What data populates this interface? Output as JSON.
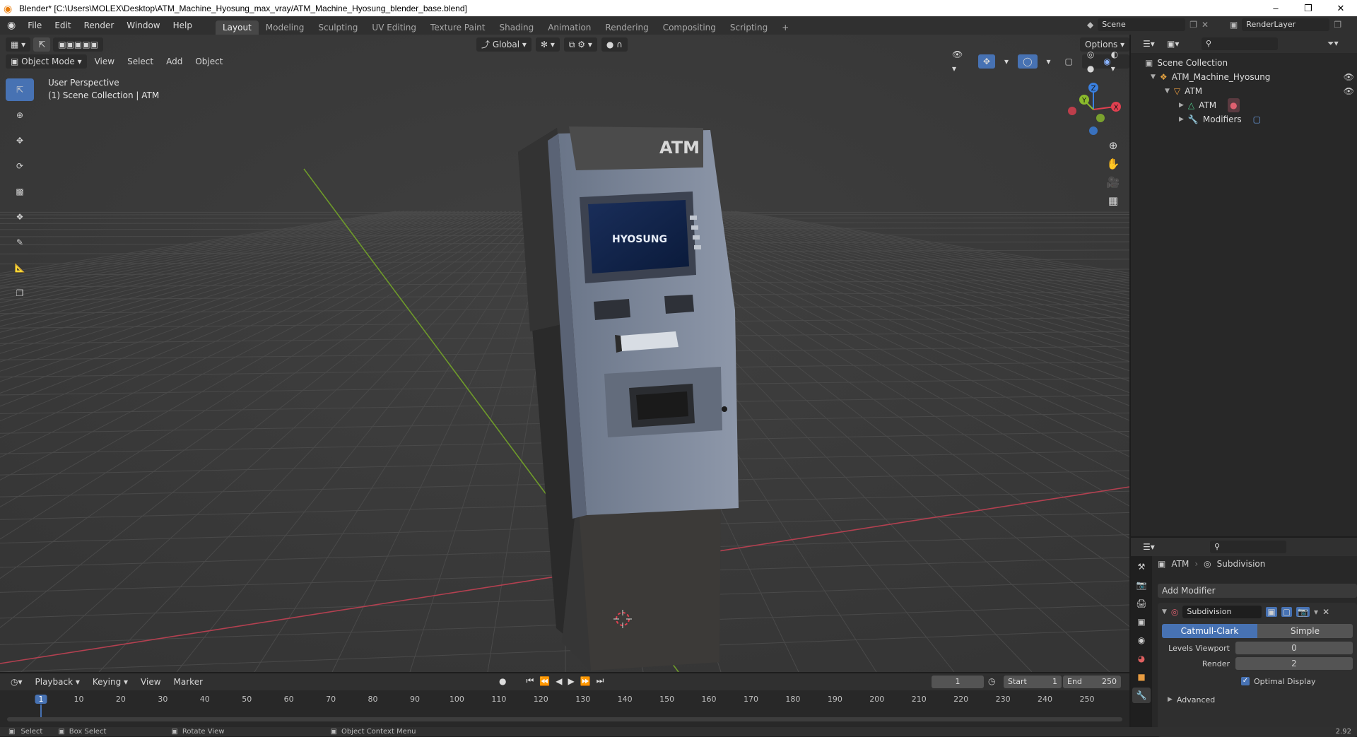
{
  "window": {
    "title": "Blender* [C:\\Users\\MOLEX\\Desktop\\ATM_Machine_Hyosung_max_vray/ATM_Machine_Hyosung_blender_base.blend]"
  },
  "menu": [
    "File",
    "Edit",
    "Render",
    "Window",
    "Help"
  ],
  "workspaces": [
    "Layout",
    "Modeling",
    "Sculpting",
    "UV Editing",
    "Texture Paint",
    "Shading",
    "Animation",
    "Rendering",
    "Compositing",
    "Scripting"
  ],
  "active_workspace": "Layout",
  "scene": {
    "name": "Scene",
    "render_layer": "RenderLayer"
  },
  "viewport": {
    "mode": "Object Mode",
    "header_menus": [
      "View",
      "Select",
      "Add",
      "Object"
    ],
    "orientation": "Global",
    "options_label": "Options",
    "perspective_label": "User Perspective",
    "collection_label": "(1) Scene Collection | ATM",
    "atm_sign": "ATM",
    "screen_brand": "HYOSUNG"
  },
  "outliner": {
    "root": "Scene Collection",
    "items": [
      {
        "label": "ATM_Machine_Hyosung",
        "icon": "collection-icon"
      },
      {
        "label": "ATM",
        "icon": "object-icon"
      },
      {
        "label": "ATM",
        "icon": "mesh-icon"
      },
      {
        "label": "Modifiers",
        "icon": "wrench-icon"
      }
    ]
  },
  "properties": {
    "object_name": "ATM",
    "modifier_context": "Subdivision",
    "add_modifier": "Add Modifier",
    "modifier_name": "Subdivision",
    "type_options": [
      "Catmull-Clark",
      "Simple"
    ],
    "active_type": "Catmull-Clark",
    "levels_viewport_label": "Levels Viewport",
    "levels_viewport": "0",
    "render_label": "Render",
    "render": "2",
    "optimal_display_label": "Optimal Display",
    "advanced_label": "Advanced"
  },
  "timeline": {
    "menus": [
      "Playback",
      "Keying",
      "View",
      "Marker"
    ],
    "current_frame": "1",
    "start_label": "Start",
    "start": "1",
    "end_label": "End",
    "end": "250",
    "ticks": [
      "1",
      "10",
      "20",
      "30",
      "40",
      "50",
      "60",
      "70",
      "80",
      "90",
      "100",
      "110",
      "120",
      "130",
      "140",
      "150",
      "160",
      "170",
      "180",
      "190",
      "200",
      "210",
      "220",
      "230",
      "240",
      "250"
    ]
  },
  "statusbar": {
    "select": "Select",
    "box_select": "Box Select",
    "rotate_view": "Rotate View",
    "context_menu": "Object Context Menu",
    "version": "2.92"
  },
  "colors": {
    "accent": "#4772b3",
    "x_axis": "#e04050",
    "y_axis": "#8bbb2c",
    "z_axis": "#3a80e0"
  }
}
